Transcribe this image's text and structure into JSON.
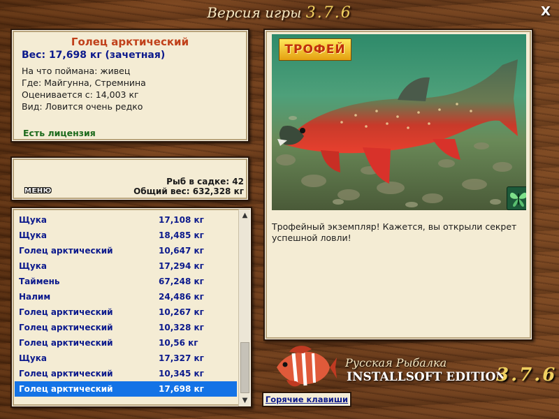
{
  "window": {
    "title_prefix": "Версия игры",
    "title_version": "3.7.6",
    "close_label": "X"
  },
  "catch": {
    "name": "Голец арктический",
    "weight": "Вес: 17,698 кг (зачетная)",
    "bait": "На что поймана: живец",
    "place": "Где: Майгунна, Стремнина",
    "rated": "Оценивается с: 14,003 кг",
    "kind": "Вид: Ловится очень редко",
    "license": "Есть лицензия"
  },
  "summary": {
    "menu_label": "МЕНЮ",
    "fish_count": "Рыб в садке: 42",
    "total_weight": "Общий вес: 632,328 кг"
  },
  "fish_list": [
    {
      "name": "Щука",
      "weight": "17,108 кг"
    },
    {
      "name": "Щука",
      "weight": "18,485 кг"
    },
    {
      "name": "Голец арктический",
      "weight": "10,647 кг"
    },
    {
      "name": "Щука",
      "weight": "17,294 кг"
    },
    {
      "name": "Таймень",
      "weight": "67,248 кг"
    },
    {
      "name": "Налим",
      "weight": "24,486 кг"
    },
    {
      "name": "Голец арктический",
      "weight": "10,267 кг"
    },
    {
      "name": "Голец арктический",
      "weight": "10,328 кг"
    },
    {
      "name": "Голец арктический",
      "weight": "10,56 кг"
    },
    {
      "name": "Щука",
      "weight": "17,327 кг"
    },
    {
      "name": "Голец арктический",
      "weight": "10,345 кг"
    },
    {
      "name": "Голец арктический",
      "weight": "17,698 кг",
      "selected": true
    }
  ],
  "trophy": {
    "badge": "ТРОФЕЙ",
    "message": "Трофейный экземпляр! Кажется, вы открыли секрет успешной ловли!"
  },
  "brand": {
    "title": "Русская Рыбалка",
    "edition": "INSTALLSOFT EDITION",
    "version": "3.7.6"
  },
  "hotkeys_label": "Горячие клавиши",
  "colors": {
    "accent_blue": "#0c1a8c",
    "fish_name_red": "#c0401a",
    "license_green": "#1c6a1c",
    "selection_blue": "#1473e6"
  }
}
